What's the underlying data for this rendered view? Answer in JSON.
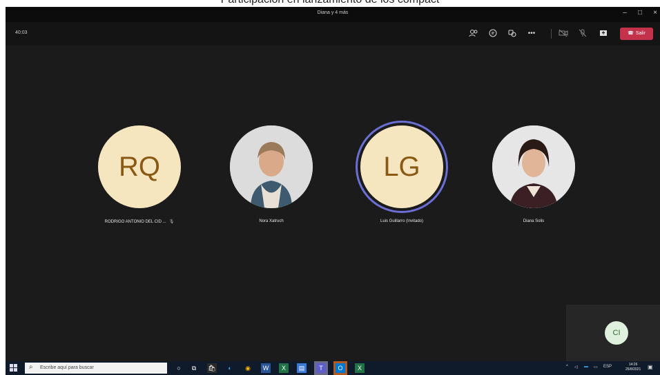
{
  "caption": "Participación en lanzamiento de los compact",
  "window": {
    "title": "Diana y 4 más",
    "minimize": "–",
    "maximize": "□",
    "close": "×"
  },
  "toolbar": {
    "timer": "40:03",
    "leave_label": "Salir",
    "icons": [
      "people-icon",
      "chat-icon",
      "reactions-icon",
      "more-icon",
      "camera-icon",
      "microphone-icon",
      "share-icon"
    ]
  },
  "participants": [
    {
      "name": "RODRIGO ANTONIO DEL CID ...",
      "initials": "RQ",
      "type": "initials",
      "speaking": false,
      "muted": true
    },
    {
      "name": "Nora Xatruch",
      "type": "photo",
      "speaking": false,
      "muted": false
    },
    {
      "name": "Luis Guillarro (Invitado)",
      "initials": "LG",
      "type": "initials",
      "speaking": true,
      "muted": false
    },
    {
      "name": "Diana Solis",
      "type": "photo",
      "speaking": false,
      "muted": false
    }
  ],
  "self_view": {
    "initials": "CI"
  },
  "taskbar": {
    "search_placeholder": "Escribe aquí para buscar",
    "apps": [
      "task-view-icon",
      "file-explorer-icon",
      "store-icon",
      "edge-icon",
      "chrome-icon",
      "word-icon",
      "excel-icon",
      "files-icon",
      "teams-icon",
      "outlook-icon",
      "excel-2-icon"
    ],
    "language": "ESP",
    "time": "14:26",
    "date": "25/8/2021"
  },
  "colors": {
    "leave": "#c4314b",
    "speaking_ring": "#6b6fd4",
    "avatar_bg": "#f5e6c0",
    "avatar_text": "#8a5a14"
  }
}
